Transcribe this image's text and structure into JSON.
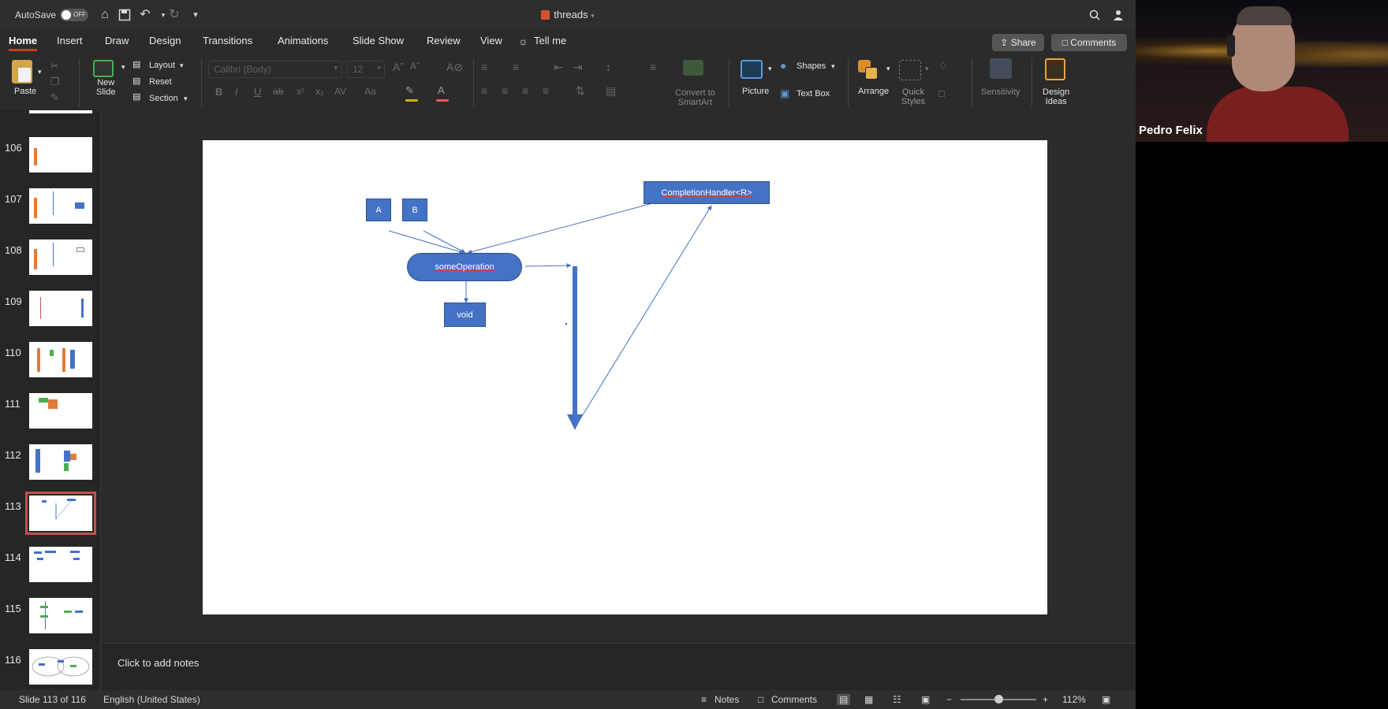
{
  "titlebar": {
    "autosave_label": "AutoSave",
    "autosave_state": "OFF",
    "document_title": "threads"
  },
  "tabs": [
    {
      "label": "Home",
      "active": true
    },
    {
      "label": "Insert"
    },
    {
      "label": "Draw"
    },
    {
      "label": "Design"
    },
    {
      "label": "Transitions"
    },
    {
      "label": "Animations"
    },
    {
      "label": "Slide Show"
    },
    {
      "label": "Review"
    },
    {
      "label": "View"
    },
    {
      "label": "Tell me"
    }
  ],
  "actions": {
    "share": "Share",
    "comments": "Comments"
  },
  "ribbon": {
    "paste": "Paste",
    "new_slide": "New\nSlide",
    "layout": "Layout",
    "reset": "Reset",
    "section": "Section",
    "font_name": "Calibri (Body)",
    "font_size": "12",
    "convert_smartart": "Convert to\nSmartArt",
    "picture": "Picture",
    "shapes": "Shapes",
    "text_box": "Text Box",
    "arrange": "Arrange",
    "quick_styles": "Quick\nStyles",
    "sensitivity": "Sensitivity",
    "design_ideas": "Design\nIdeas"
  },
  "thumbnails": [
    {
      "num": "106"
    },
    {
      "num": "107"
    },
    {
      "num": "108"
    },
    {
      "num": "109"
    },
    {
      "num": "110"
    },
    {
      "num": "111"
    },
    {
      "num": "112"
    },
    {
      "num": "113",
      "selected": true
    },
    {
      "num": "114"
    },
    {
      "num": "115"
    },
    {
      "num": "116"
    }
  ],
  "slide": {
    "box_a": "A",
    "box_b": "B",
    "operation": "someOperation",
    "void": "void",
    "handler": "CompletionHandler<R>",
    "shape_color": "#4472c4"
  },
  "notes": {
    "placeholder": "Click to add notes"
  },
  "status": {
    "slide_info": "Slide 113 of 116",
    "language": "English (United States)",
    "notes": "Notes",
    "comments": "Comments",
    "zoom": "112%"
  },
  "video": {
    "participant_name": "Pedro Felix"
  },
  "accent_color": "#c43e1c"
}
